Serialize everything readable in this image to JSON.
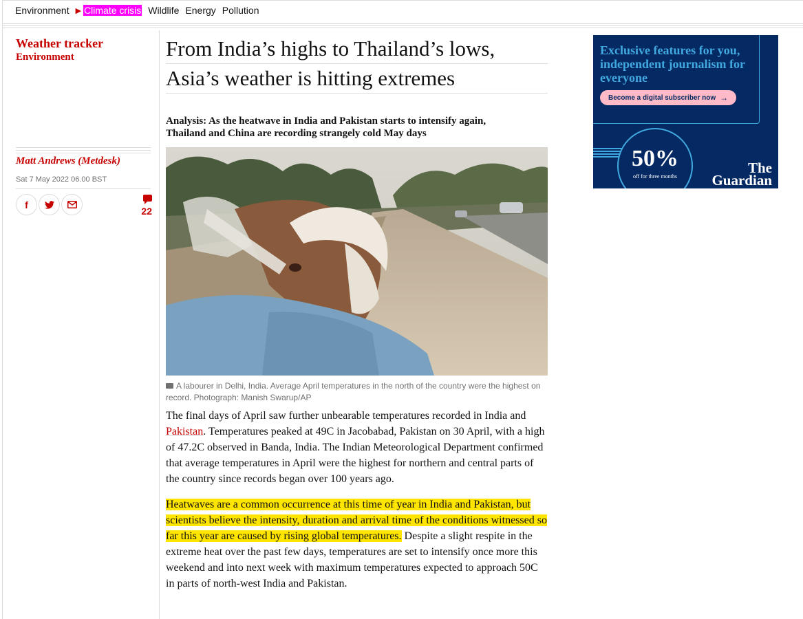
{
  "subnav": {
    "items": [
      "Environment",
      "Climate crisis",
      "Wildlife",
      "Energy",
      "Pollution"
    ],
    "active_index": 1
  },
  "left": {
    "series": "Weather tracker",
    "section": "Environment",
    "byline": "Matt Andrews (Metdesk)",
    "date": "Sat 7 May 2022 06.00 BST",
    "comment_count": "22",
    "share_icons": [
      "facebook-icon",
      "twitter-icon",
      "email-icon"
    ]
  },
  "article": {
    "headline_line1": "From India’s highs to Thailand’s lows,",
    "headline_line2": "Asia’s weather is hitting extremes",
    "standfirst": "Analysis: As the heatwave in India and Pakistan starts to intensify again, Thailand and China are recording strangely cold May days",
    "caption": "A labourer in Delhi, India. Average April temperatures in the north of the country were the highest on record. Photograph: Manish Swarup/AP",
    "p1_before": "The final days of April saw further unbearable temperatures recorded in India and ",
    "p1_link": "Pakistan",
    "p1_after": ". Temperatures peaked at 49C in Jacobabad, Pakistan on 30 April, with a high of 47.2C observed in Banda, India. The Indian Meteorological Department confirmed that average temperatures in April were the highest for northern and central parts of the country since records began over 100 years ago.",
    "p2_highlight": "Heatwaves are a common occurrence at this time of year in India and Pakistan, but scientists believe the intensity, duration and arrival time of the conditions witnessed so far this year are caused by rising global temperatures.",
    "p2_after": " Despite a slight respite in the extreme heat over the past few days, temperatures are set to intensify once more this weekend and into next week with maximum temperatures expected to approach 50C in parts of north-west India and Pakistan."
  },
  "ad": {
    "headline": "Exclusive features for you, independent journalism for everyone",
    "button": "Become a digital subscriber now",
    "percent": "50%",
    "offer": "off for three months",
    "logo_line1": "The",
    "logo_line2": "Guardian"
  },
  "colors": {
    "accent": "#c70000",
    "highlight": "#ffe500",
    "nav_active": "#ff00ff",
    "ad_bg": "#052962",
    "ad_accent": "#41a9e0",
    "ad_button": "#ffbac8"
  }
}
